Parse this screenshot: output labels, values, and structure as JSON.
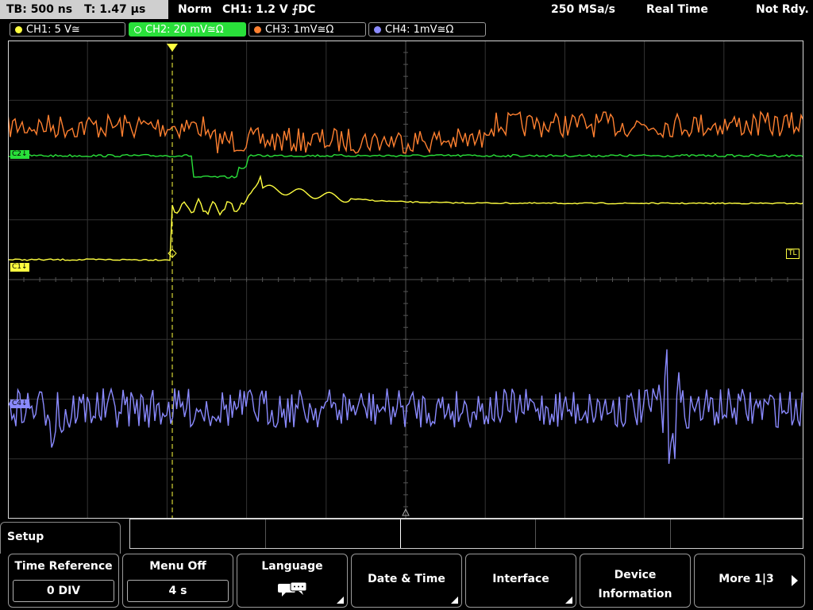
{
  "status": {
    "timebase": "TB: 500 ns",
    "trigger_time": "T: 1.47 µs",
    "trigger_mode": "Norm",
    "trigger_info": "CH1: 1.2 V ⨍DC",
    "sample_rate": "250 MSa/s",
    "acq_mode": "Real Time",
    "state": "Not Rdy."
  },
  "channels": [
    {
      "label": "CH1: 5 V≅",
      "color": "#ffff40"
    },
    {
      "label": "CH2: 20 mV≅Ω",
      "color": "#29e03a"
    },
    {
      "label": "CH3: 1mV≅Ω",
      "color": "#ff8030"
    },
    {
      "label": "CH4: 1mV≅Ω",
      "color": "#8a8aff"
    }
  ],
  "markers": {
    "ch1": "C1↓",
    "ch2": "C2↓",
    "ch4": "C4↓",
    "trigger_level": "TL"
  },
  "menu": {
    "title": "Setup",
    "softkeys": [
      {
        "label": "Time Reference",
        "value": "0 DIV"
      },
      {
        "label": "Menu Off",
        "value": "4 s"
      },
      {
        "label": "Language",
        "icon": "speech-bubble-icon"
      },
      {
        "label": "Date & Time"
      },
      {
        "label": "Interface"
      },
      {
        "label": "Device\nInformation",
        "line1": "Device",
        "line2": "Information"
      },
      {
        "label": "More 1|3"
      }
    ]
  }
}
